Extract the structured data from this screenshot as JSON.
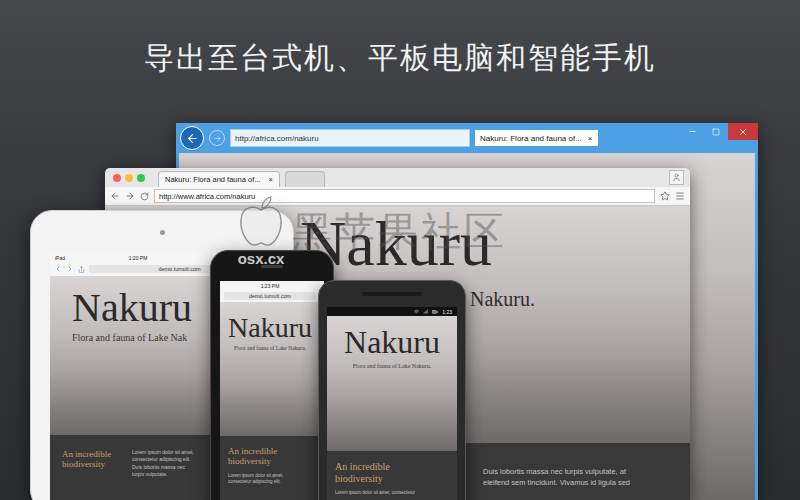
{
  "headline": "导出至台式机、平板电脑和智能手机",
  "ie_window": {
    "address": "http://africa.com/nakuru",
    "tab": "Nakuru: Flora and fauna of...",
    "tab_close": "×"
  },
  "chrome_window": {
    "tab": "Nakuru: Flora and fauna of...",
    "tab_close": "×",
    "address": "http://www.africa.com/nakuru",
    "page": {
      "title": "Nakuru",
      "subtitle": "Nakuru.",
      "body": [
        "Duis lobortis massa nec turpis vulputate, at",
        "eleifend sem tincidunt. Vivamus id ligula sed"
      ]
    }
  },
  "ipad": {
    "carrier": "iPad",
    "time": "1:20 PM",
    "address": "demo.tumult.com",
    "page": {
      "title": "Nakuru",
      "subtitle": "Flora and fauna of Lake Nak",
      "heading": "An incredible biodiversity",
      "body": [
        "Lorem ipsum dolor sit amet,",
        "consectetur adipiscing elit.",
        "Duis lobortis massa nec",
        "turpis vulputate."
      ]
    }
  },
  "iphone": {
    "time": "1:23 PM",
    "address": "demo.tumult.com",
    "page": {
      "title": "Nakuru",
      "subtitle": "Flora and fauna of Lake Nakuru.",
      "heading": "An incredible biodiversity",
      "body": [
        "Lorem ipsum dolor sit amet,",
        "consectetur adipiscing elit."
      ]
    }
  },
  "htc": {
    "time": "1:23",
    "page": {
      "title": "Nakuru",
      "subtitle": "Flora and fauna of Lake Nakuru.",
      "heading": "An incredible biodiversity",
      "body": [
        "Lorem ipsum dolor sit amet, consectetur"
      ]
    }
  },
  "watermark": {
    "title": "黑苹果社区",
    "site": "osx.cx"
  }
}
